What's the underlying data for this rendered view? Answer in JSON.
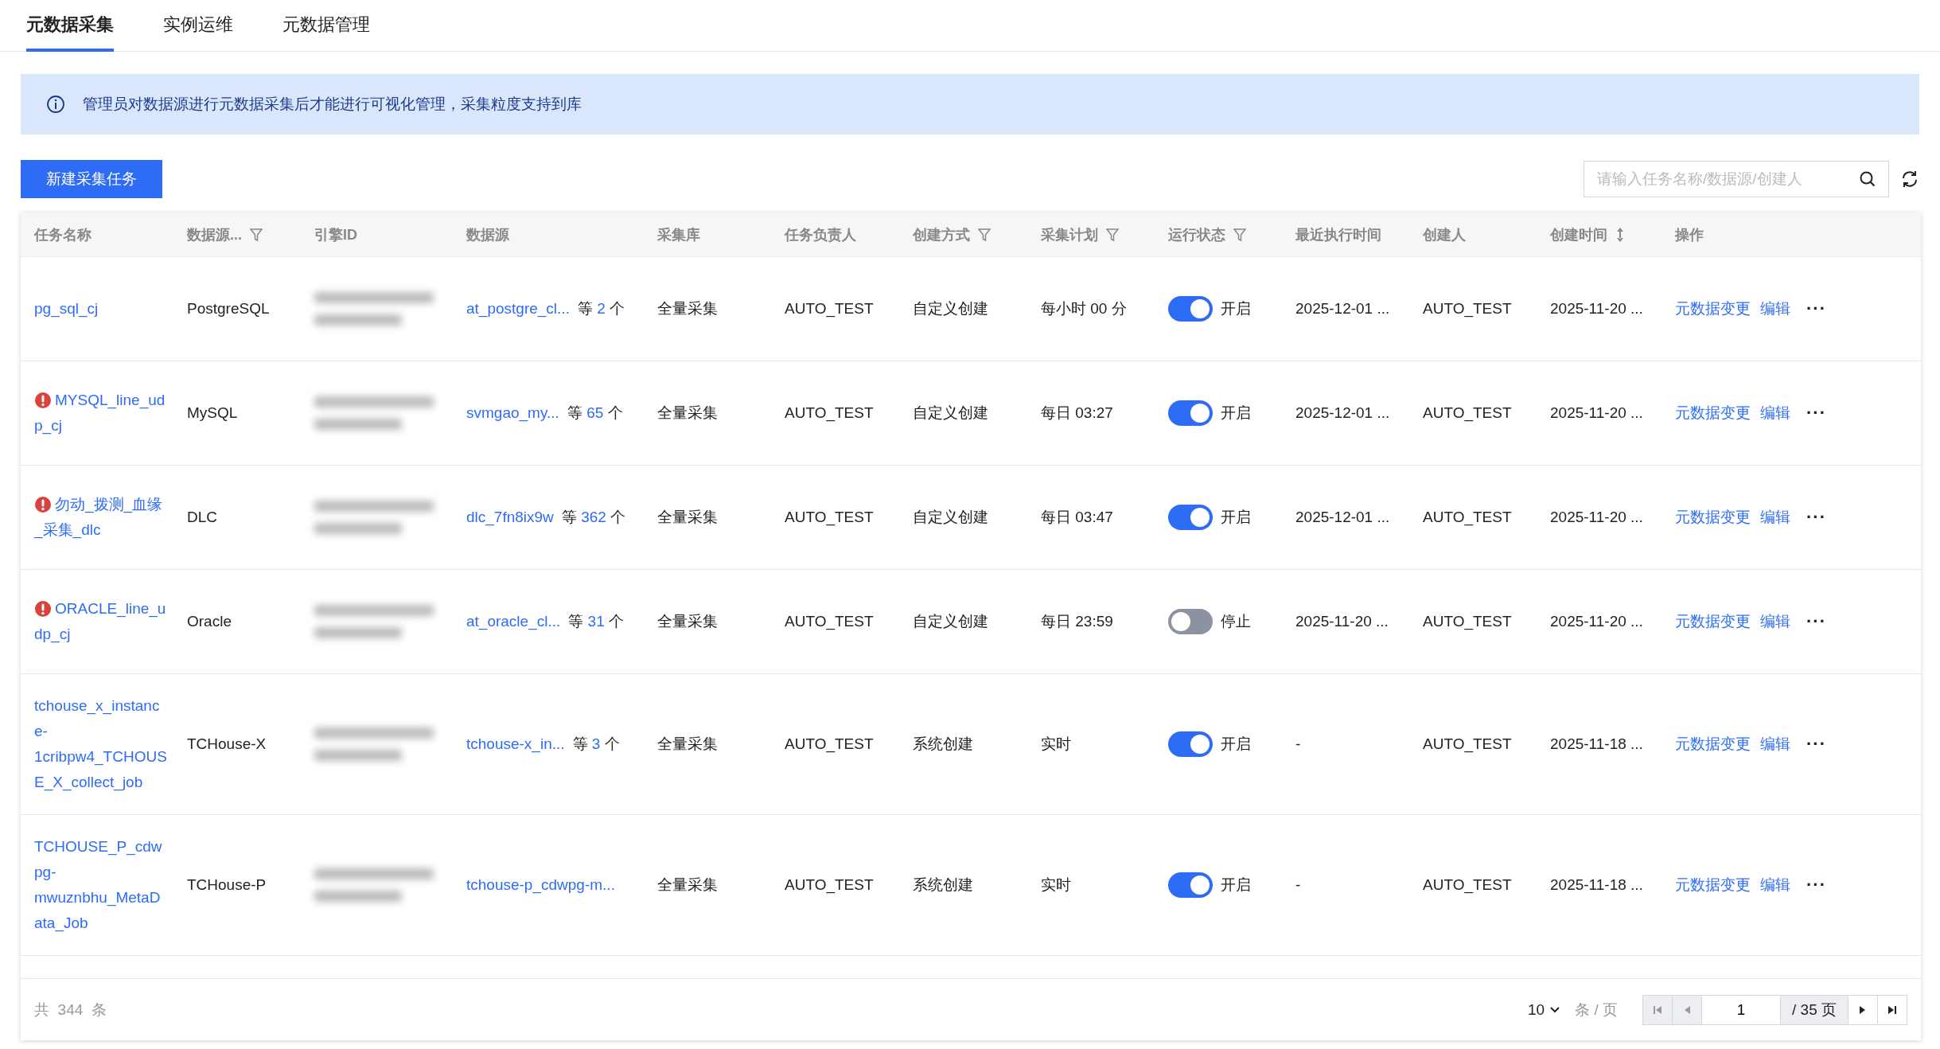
{
  "tabs": [
    {
      "label": "元数据采集",
      "selected": true
    },
    {
      "label": "实例运维",
      "selected": false
    },
    {
      "label": "元数据管理",
      "selected": false
    }
  ],
  "notice": {
    "text": "管理员对数据源进行元数据采集后才能进行可视化管理，采集粒度支持到库"
  },
  "toolbar": {
    "create_button": "新建采集任务",
    "search": {
      "placeholder": "请输入任务名称/数据源/创建人"
    }
  },
  "table": {
    "columns": [
      {
        "label": "任务名称",
        "kind": "plain"
      },
      {
        "label": "数据源...",
        "kind": "filterable"
      },
      {
        "label": "引擎ID",
        "kind": "plain"
      },
      {
        "label": "数据源",
        "kind": "plain"
      },
      {
        "label": "采集库",
        "kind": "plain"
      },
      {
        "label": "任务负责人",
        "kind": "plain"
      },
      {
        "label": "创建方式",
        "kind": "filterable"
      },
      {
        "label": "采集计划",
        "kind": "filterable"
      },
      {
        "label": "运行状态",
        "kind": "filterable"
      },
      {
        "label": "最近执行时间",
        "kind": "plain"
      },
      {
        "label": "创建人",
        "kind": "plain"
      },
      {
        "label": "创建时间",
        "kind": "sortable"
      },
      {
        "label": "操作",
        "kind": "plain"
      }
    ],
    "rows": [
      {
        "name": "pg_sql_cj",
        "warning": false,
        "source_type": "PostgreSQL",
        "engine_id_blurred": true,
        "datasource": {
          "name": "at_postgre_cl...",
          "more_label": "等",
          "more_count": "2",
          "more_unit": "个"
        },
        "scope": "全量采集",
        "owner": "AUTO_TEST",
        "creation": "自定义创建",
        "schedule": "每小时 00 分",
        "on": true,
        "status": "开启",
        "last_run": "2025-12-01 ...",
        "creator": "AUTO_TEST",
        "created": "2025-11-20 ...",
        "actions": [
          "元数据变更",
          "编辑"
        ],
        "more": "···"
      },
      {
        "name": "MYSQL_line_udp_cj",
        "warning": true,
        "source_type": "MySQL",
        "engine_id_blurred": true,
        "datasource": {
          "name": "svmgao_my...",
          "more_label": "等",
          "more_count": "65",
          "more_unit": "个"
        },
        "scope": "全量采集",
        "owner": "AUTO_TEST",
        "creation": "自定义创建",
        "schedule": "每日 03:27",
        "on": true,
        "status": "开启",
        "last_run": "2025-12-01 ...",
        "creator": "AUTO_TEST",
        "created": "2025-11-20 ...",
        "actions": [
          "元数据变更",
          "编辑"
        ],
        "more": "···"
      },
      {
        "name": "勿动_拨测_血缘_采集_dlc",
        "warning": true,
        "source_type": "DLC",
        "engine_id_blurred": true,
        "datasource": {
          "name": "dlc_7fn8ix9w",
          "more_label": "等",
          "more_count": "362",
          "more_unit": "个"
        },
        "scope": "全量采集",
        "owner": "AUTO_TEST",
        "creation": "自定义创建",
        "schedule": "每日 03:47",
        "on": true,
        "status": "开启",
        "last_run": "2025-12-01 ...",
        "creator": "AUTO_TEST",
        "created": "2025-11-20 ...",
        "actions": [
          "元数据变更",
          "编辑"
        ],
        "more": "···"
      },
      {
        "name": "ORACLE_line_udp_cj",
        "warning": true,
        "source_type": "Oracle",
        "engine_id_blurred": true,
        "datasource": {
          "name": "at_oracle_cl...",
          "more_label": "等",
          "more_count": "31",
          "more_unit": "个"
        },
        "scope": "全量采集",
        "owner": "AUTO_TEST",
        "creation": "自定义创建",
        "schedule": "每日 23:59",
        "on": false,
        "status": "停止",
        "last_run": "2025-11-20 ...",
        "creator": "AUTO_TEST",
        "created": "2025-11-20 ...",
        "actions": [
          "元数据变更",
          "编辑"
        ],
        "more": "···"
      },
      {
        "name": "tchouse_x_instance-1cribpw4_TCHOUSE_X_collect_job",
        "warning": false,
        "source_type": "TCHouse-X",
        "engine_id_blurred": true,
        "datasource": {
          "name": "tchouse-x_in...",
          "more_label": "等",
          "more_count": "3",
          "more_unit": "个"
        },
        "scope": "全量采集",
        "owner": "AUTO_TEST",
        "creation": "系统创建",
        "schedule": "实时",
        "on": true,
        "status": "开启",
        "last_run": "-",
        "creator": "AUTO_TEST",
        "created": "2025-11-18 ...",
        "actions": [
          "元数据变更",
          "编辑"
        ],
        "more": "···"
      },
      {
        "name": "TCHOUSE_P_cdwpg-mwuznbhu_MetaData_Job",
        "warning": false,
        "source_type": "TCHouse-P",
        "engine_id_blurred": true,
        "datasource": {
          "name": "tchouse-p_cdwpg-m..."
        },
        "scope": "全量采集",
        "owner": "AUTO_TEST",
        "creation": "系统创建",
        "schedule": "实时",
        "on": true,
        "status": "开启",
        "last_run": "-",
        "creator": "AUTO_TEST",
        "created": "2025-11-18 ...",
        "actions": [
          "元数据变更",
          "编辑"
        ],
        "more": "···"
      }
    ]
  },
  "pagination": {
    "total_prefix": "共",
    "total": "344",
    "total_suffix": "条",
    "page_size": "10",
    "page_size_unit": "条 / 页",
    "page": "1",
    "page_count": "/ 35 页"
  }
}
